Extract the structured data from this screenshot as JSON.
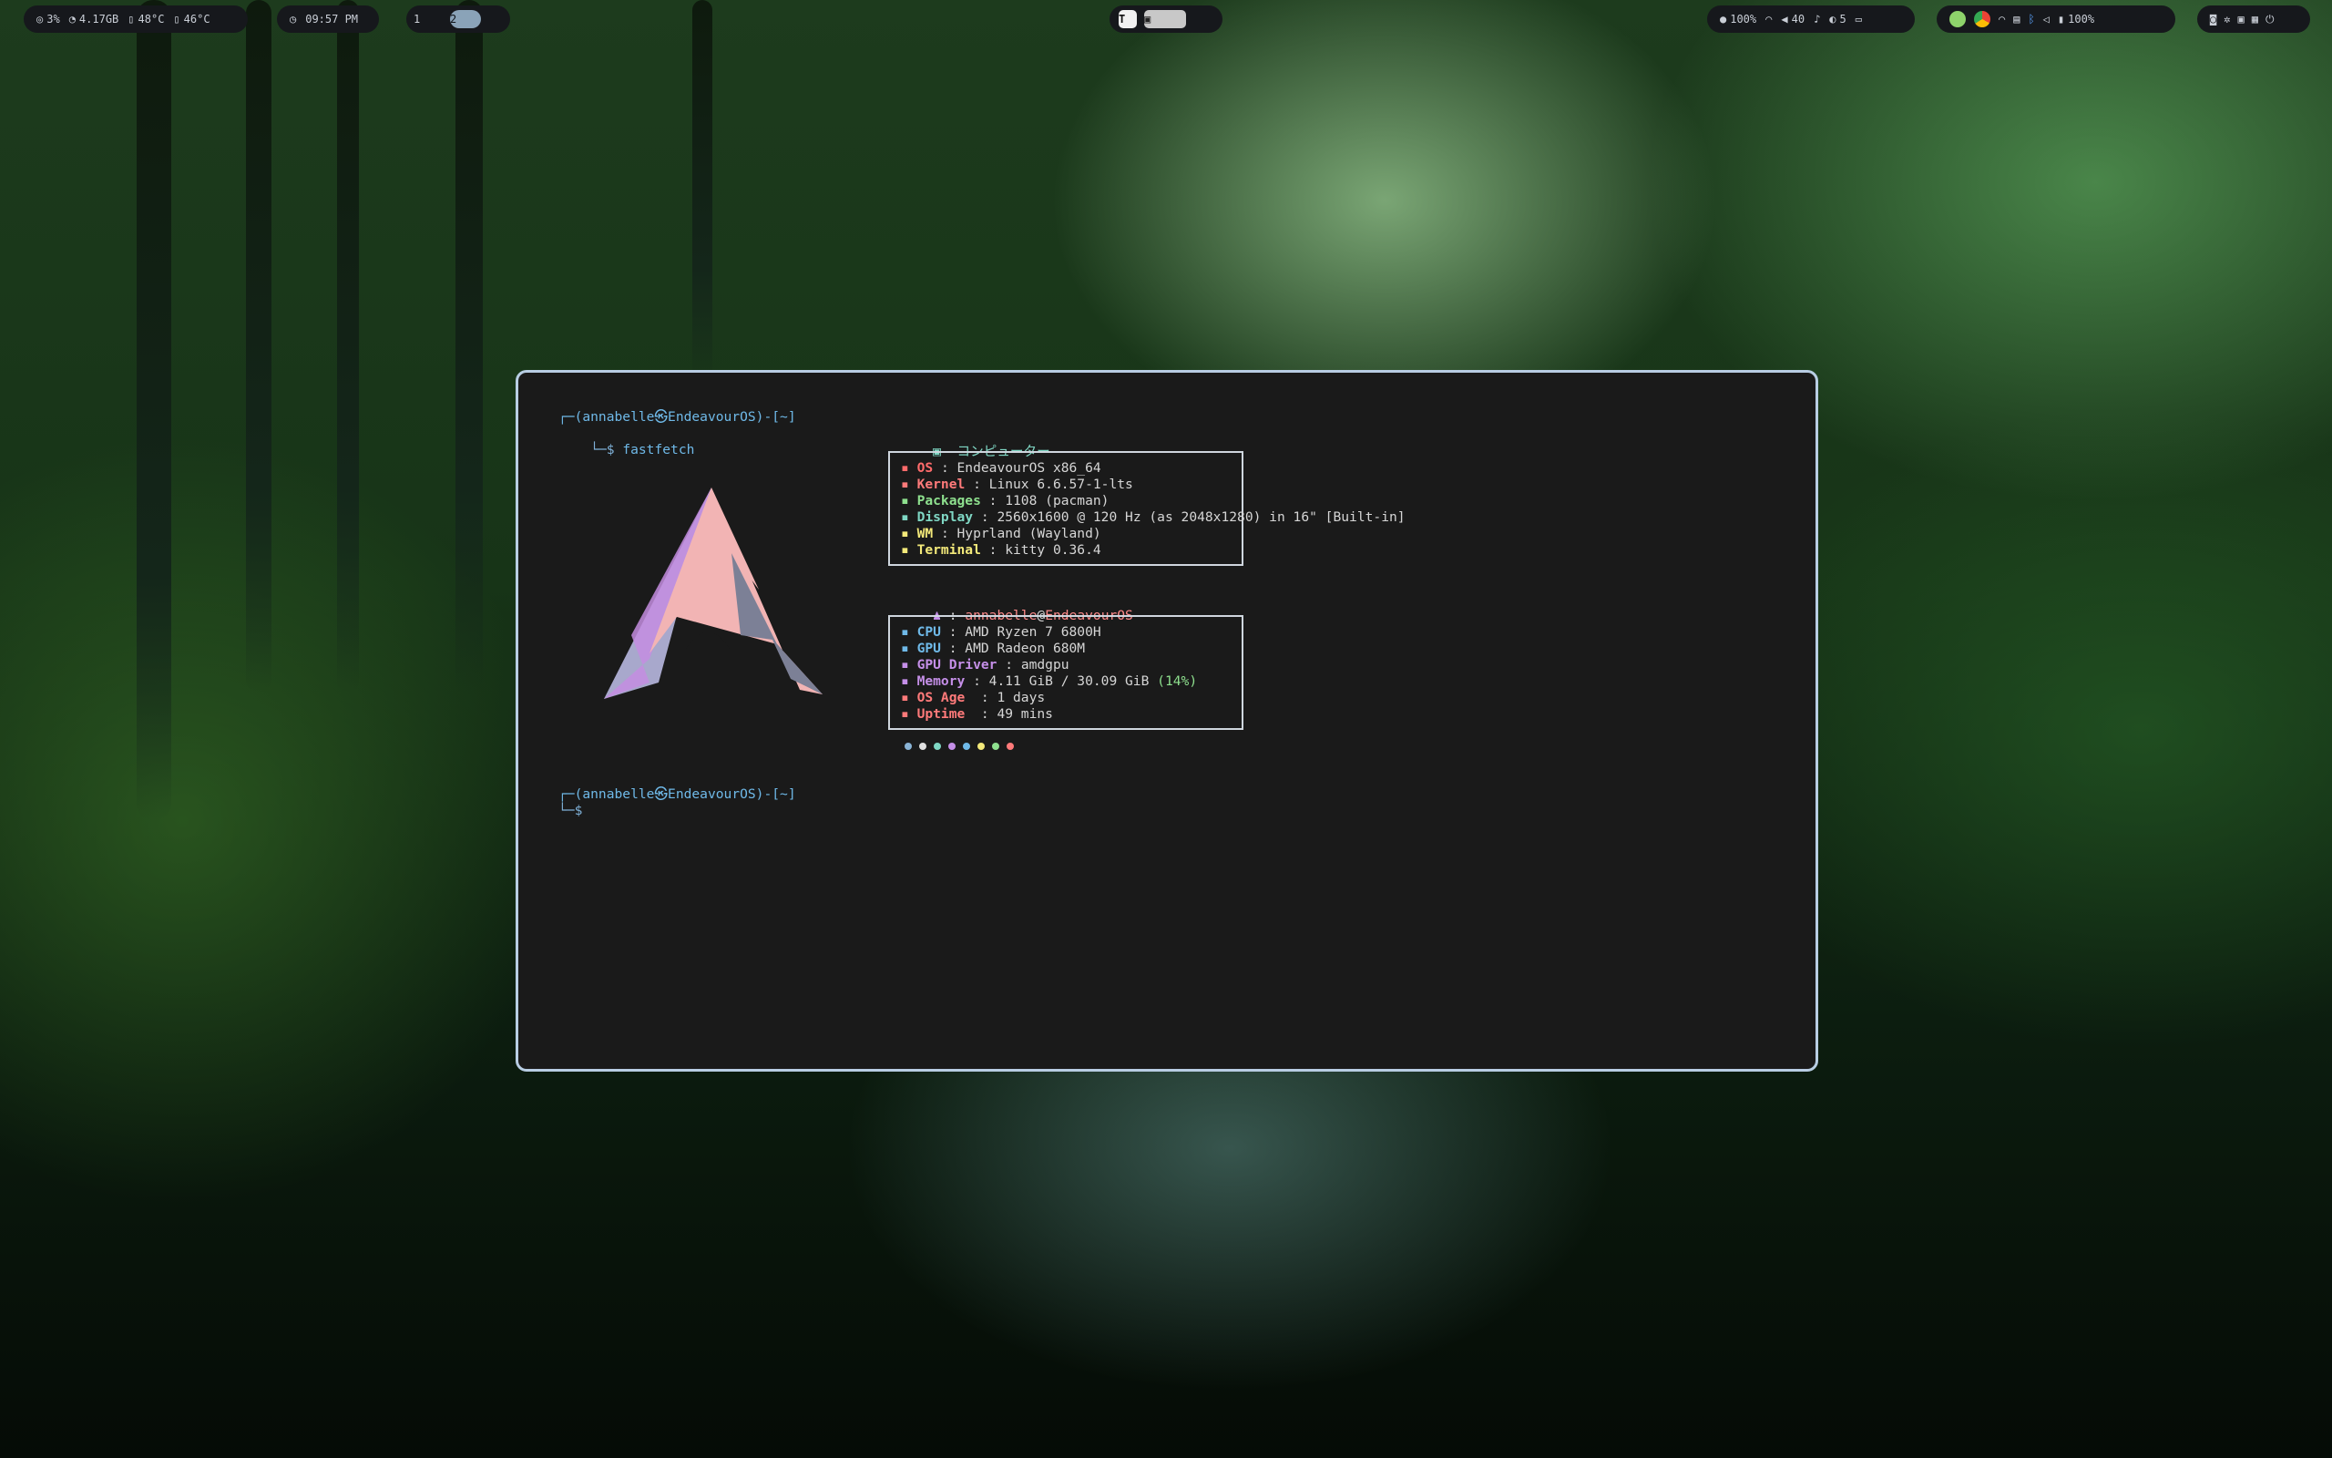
{
  "statusbar": {
    "left": {
      "cpu": "3%",
      "mem": "4.17GB",
      "temp1": "48°C",
      "temp2": "46°C"
    },
    "clock": "09:57 PM",
    "workspaces": [
      "1",
      "2"
    ],
    "active_workspace": "2",
    "center": {
      "icons": [
        "text-app-icon",
        "cat-app-icon"
      ]
    },
    "right": {
      "brightness": "100%",
      "volume": "40",
      "notifications": "5",
      "battery": "100%"
    }
  },
  "terminal": {
    "prompt_line": "┌─(annabelle㉿EndeavourOS)-[~]",
    "command_prefix": "└─$",
    "command": "fastfetch",
    "logo": "endeavouros-logo",
    "header_icon": "computer-icon",
    "header": "コンピューター",
    "system": [
      {
        "key": "OS",
        "sep": " : ",
        "value": "EndeavourOS x86_64",
        "color": "#ff6b6b"
      },
      {
        "key": "Kernel",
        "sep": " : ",
        "value": "Linux 6.6.57-1-lts",
        "color": "#ff7a7a"
      },
      {
        "key": "Packages",
        "sep": " : ",
        "value": "1108 (pacman)",
        "color": "#8ee08e"
      },
      {
        "key": "Display",
        "sep": " : ",
        "value": "2560x1600 @ 120 Hz (as 2048x1280) in 16\" [Built-in]",
        "color": "#7fd7c4"
      },
      {
        "key": "WM",
        "sep": " : ",
        "value": "Hyprland (Wayland)",
        "color": "#f3e97a"
      },
      {
        "key": "Terminal",
        "sep": " : ",
        "value": "kitty 0.36.4",
        "color": "#f3e97a"
      }
    ],
    "user_line": {
      "user": "annabelle",
      "at": "@",
      "host": "EndeavourOS",
      "sep": " : "
    },
    "hardware": [
      {
        "key": "CPU",
        "sep": " : ",
        "value": "AMD Ryzen 7 6800H",
        "color": "#6fb9e8"
      },
      {
        "key": "GPU",
        "sep": " : ",
        "value": "AMD Radeon 680M",
        "color": "#6fb9e8"
      },
      {
        "key": "GPU Driver",
        "sep": " : ",
        "value": "amdgpu",
        "color": "#c58fe8"
      },
      {
        "key": "Memory",
        "sep": " : ",
        "value": "4.11 GiB / 30.09 GiB",
        "pct": "(14%)",
        "color": "#c58fe8"
      },
      {
        "key": "OS Age",
        "sep": "  : ",
        "value": "1 days",
        "color": "#ff7a7a"
      },
      {
        "key": "Uptime",
        "sep": "  : ",
        "value": "49 mins",
        "color": "#ff7a7a"
      }
    ],
    "palette": [
      "#8ab4d6",
      "#e0e0e0",
      "#7fd7c4",
      "#c58fe8",
      "#6fb9e8",
      "#f3e97a",
      "#8ee08e",
      "#ff7a7a"
    ],
    "prompt_line2": "┌─(annabelle㉿EndeavourOS)-[~]",
    "prompt_prefix2": "└─$"
  }
}
